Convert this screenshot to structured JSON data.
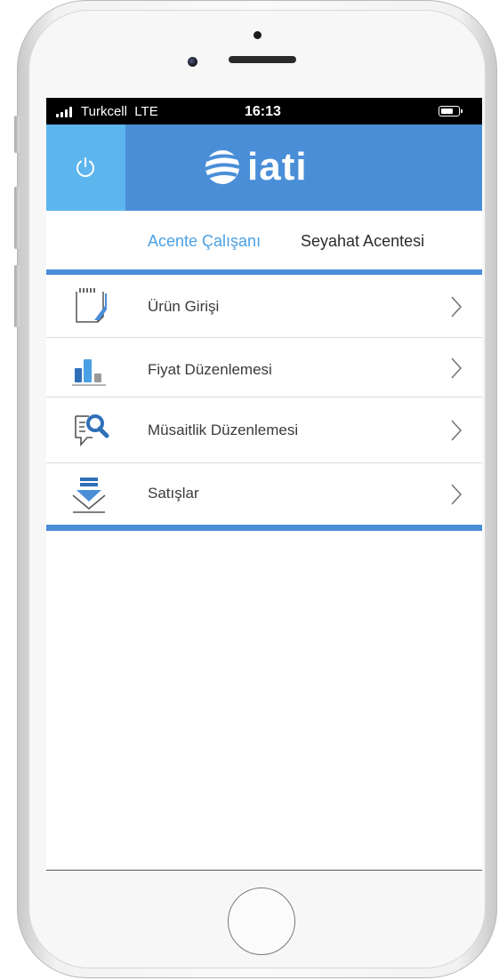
{
  "status_bar": {
    "carrier": "Turkcell",
    "network": "LTE",
    "time": "16:13",
    "battery_level": 0.75
  },
  "header": {
    "logo_text": "iati",
    "power_icon": "power-icon",
    "logo_icon": "iati-logo-icon",
    "bg_color": "#4a8ed8",
    "power_bg_color": "#5db5ee"
  },
  "tabs": [
    {
      "label": "Acente Çalışanı",
      "active": true
    },
    {
      "label": "Seyahat Acentesi",
      "active": false
    }
  ],
  "menu": {
    "items": [
      {
        "label": "Ürün Girişi",
        "icon": "product-entry-icon"
      },
      {
        "label": "Fiyat Düzenlemesi",
        "icon": "bar-chart-icon"
      },
      {
        "label": "Müsaitlik Düzenlemesi",
        "icon": "document-search-icon"
      },
      {
        "label": "Satışlar",
        "icon": "download-tray-icon"
      }
    ]
  }
}
